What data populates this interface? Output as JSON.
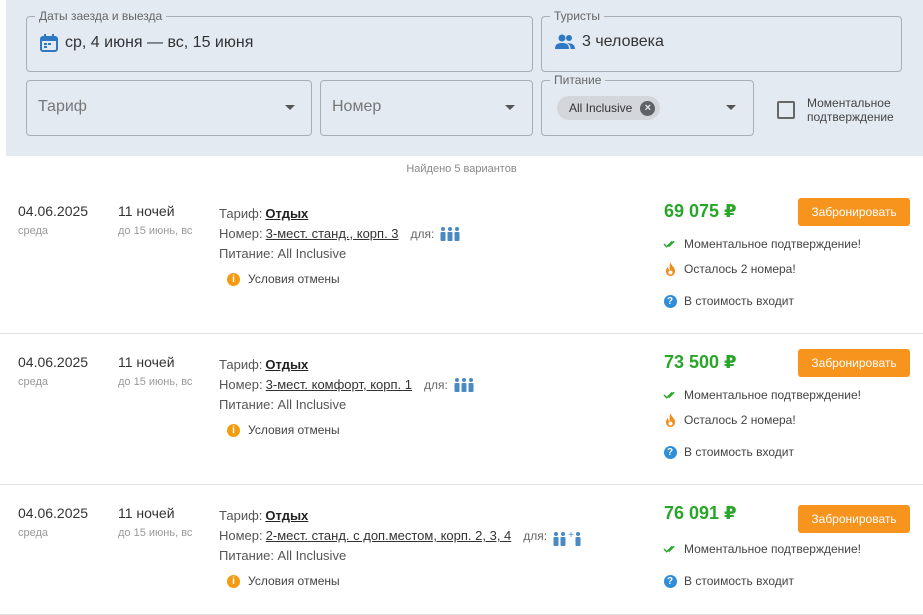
{
  "filters": {
    "dates": {
      "legend": "Даты заезда и выезда",
      "value": "ср, 4 июня — вс, 15 июня",
      "icon": "calendar-icon"
    },
    "tourists": {
      "legend": "Туристы",
      "value": "3 человека",
      "icon": "people-icon"
    },
    "tariff": {
      "placeholder": "Тариф"
    },
    "room": {
      "placeholder": "Номер"
    },
    "meal": {
      "legend": "Питание",
      "chip": "All Inclusive"
    },
    "instant": {
      "label": "Моментальное подтверждение",
      "checked": false
    }
  },
  "found_text": "Найдено 5 вариантов",
  "colors": {
    "price": "#29a529",
    "book_button": "#f7941d",
    "panel": "#e3eaf2",
    "info_icon": "#2f8ed8",
    "warn_icon": "#f39c12"
  },
  "results": [
    {
      "date": "04.06.2025",
      "weekday": "среда",
      "nights": "11 ночей",
      "until": "до 15 июнь, вс",
      "tariff_label": "Тариф:",
      "tariff": "Отдых",
      "room_label": "Номер:",
      "room": "3-мест. станд., корп. 3",
      "for_label": "для:",
      "meal_line": "Питание: All Inclusive",
      "cancel": "Условия отмены",
      "price": "69 075 ₽",
      "book": "Забронировать",
      "instant": "Моментальное подтверждение!",
      "left": "Осталось 2 номера!",
      "included": "В стоимость входит"
    },
    {
      "date": "04.06.2025",
      "weekday": "среда",
      "nights": "11 ночей",
      "until": "до 15 июнь, вс",
      "tariff_label": "Тариф:",
      "tariff": "Отдых",
      "room_label": "Номер:",
      "room": "3-мест. комфорт, корп. 1",
      "for_label": "для:",
      "meal_line": "Питание: All Inclusive",
      "cancel": "Условия отмены",
      "price": "73 500 ₽",
      "book": "Забронировать",
      "instant": "Моментальное подтверждение!",
      "left": "Осталось 2 номера!",
      "included": "В стоимость входит"
    },
    {
      "date": "04.06.2025",
      "weekday": "среда",
      "nights": "11 ночей",
      "until": "до 15 июнь, вс",
      "tariff_label": "Тариф:",
      "tariff": "Отдых",
      "room_label": "Номер:",
      "room": "2-мест. станд. с доп.местом, корп. 2, 3, 4",
      "for_label": "для:",
      "meal_line": "Питание: All Inclusive",
      "cancel": "Условия отмены",
      "price": "76 091 ₽",
      "book": "Забронировать",
      "instant": "Моментальное подтверждение!",
      "included": "В стоимость входит"
    }
  ]
}
